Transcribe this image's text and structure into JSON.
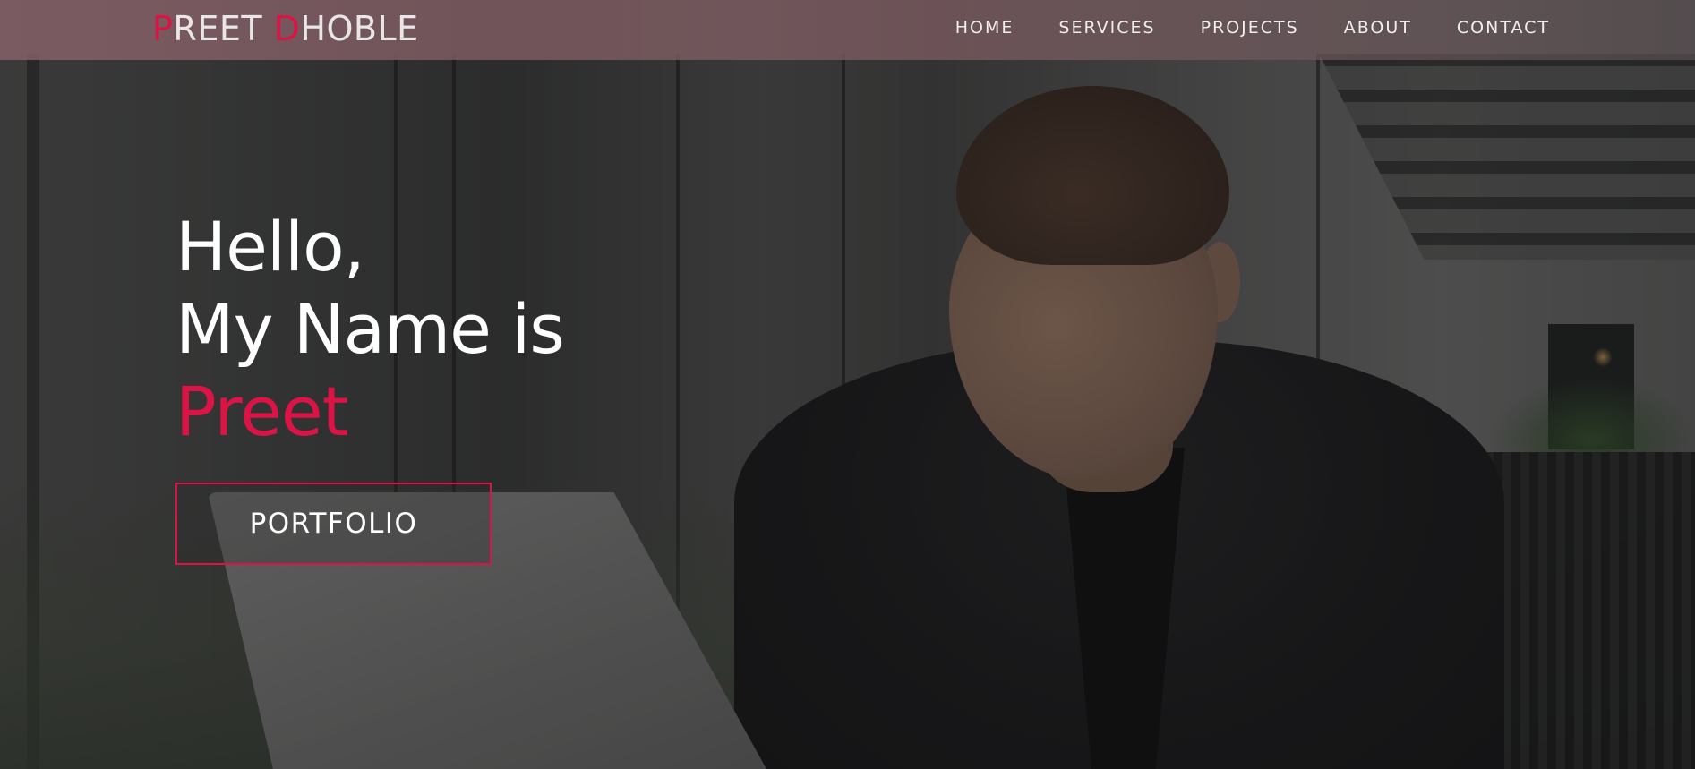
{
  "header": {
    "logo": {
      "first_initial": "P",
      "first_rest": "REET",
      "last_initial": "D",
      "last_rest": "HOBLE"
    },
    "nav_items": [
      "HOME",
      "SERVICES",
      "PROJECTS",
      "ABOUT",
      "CONTACT"
    ]
  },
  "hero": {
    "greeting": "Hello,",
    "intro": "My Name is",
    "name": "Preet",
    "button_label": "PORTFOLIO",
    "background_image": "man-working-on-laptop-photo"
  },
  "colors": {
    "accent": "#dc1446",
    "nav_bar": "#8c646c",
    "text": "#ffffff"
  }
}
